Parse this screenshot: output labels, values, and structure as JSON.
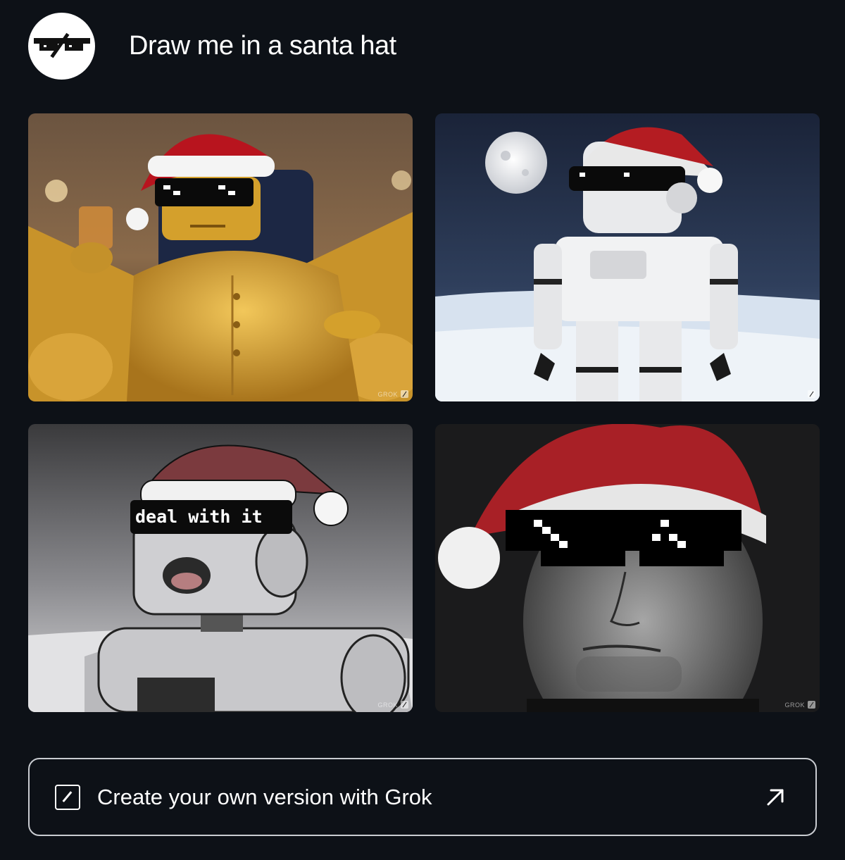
{
  "header": {
    "avatar_icon": "pixel-sunglasses-logo-icon",
    "prompt": "Draw me in a santa hat"
  },
  "images": [
    {
      "name": "golden-robot-throne-image",
      "watermark": "GROK"
    },
    {
      "name": "white-robot-moon-image",
      "watermark": ""
    },
    {
      "name": "deal-with-it-robot-image",
      "watermark": "GROK",
      "caption_on_glasses": "deal with it"
    },
    {
      "name": "man-santa-hat-sunglasses-image",
      "watermark": "GROK"
    }
  ],
  "cta": {
    "label": "Create your own version with Grok",
    "left_icon": "edit-square-icon",
    "right_icon": "arrow-up-right-icon"
  },
  "colors": {
    "background": "#0d1117",
    "text": "#ffffff",
    "cta_border": "#c9ccd1"
  }
}
